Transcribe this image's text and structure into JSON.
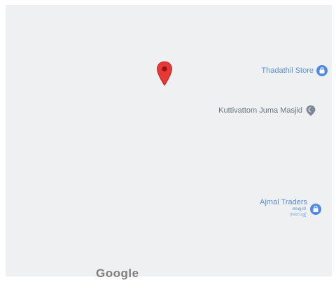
{
  "map": {
    "pin_icon": "map-pin-icon",
    "pin_color": "#e53935",
    "background_color": "#eef0f1",
    "pois": [
      {
        "name": "Thadathil Store",
        "icon": "shopping-bag-icon",
        "color": "#5a8fd8"
      },
      {
        "name": "Kuttivattom Juma Masjid",
        "icon": "mosque-icon",
        "color": "#6d7580"
      },
      {
        "name": "Ajmal Traders",
        "sub1": "അജ്മൽ",
        "sub2": "ട്രേഡേഴ്സ്",
        "icon": "shopping-bag-icon",
        "color": "#5a8fd8"
      }
    ],
    "logo_text": "Google"
  }
}
